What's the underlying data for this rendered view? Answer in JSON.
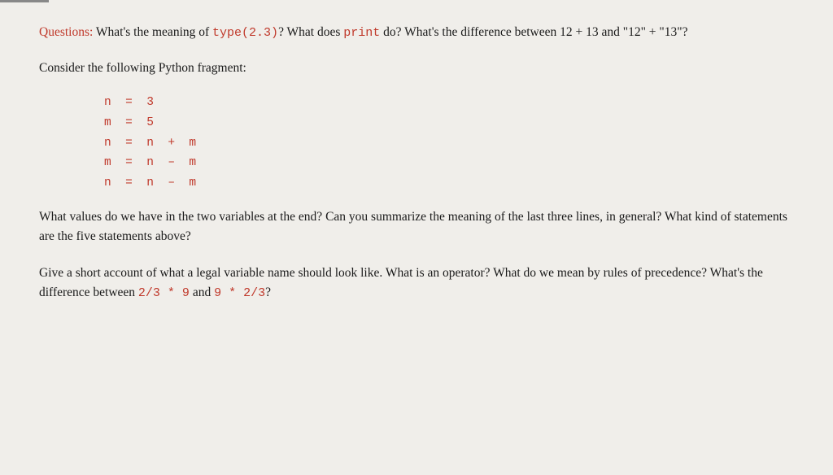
{
  "page": {
    "background": "#f0eeea",
    "top_bar": "—"
  },
  "questions": {
    "label": "Questions:",
    "text1": " What's the meaning of ",
    "code1": "type(2.3)",
    "text2": "? What does ",
    "code2": "print",
    "text3": " do? What's the difference between ",
    "code3": "12 + 13",
    "text4": " and ",
    "code4": "\"12\" + \"13\"",
    "text5": "?"
  },
  "consider": {
    "text": "Consider the following Python fragment:"
  },
  "code_lines": [
    "n  =  3",
    "m  =  5",
    "n  =  n  +  m",
    "m  =  n  –  m",
    "n  =  n  –  m"
  ],
  "values": {
    "text": "What values do we have in the two variables at the end? Can you summarize the meaning of the last three lines, in general? What kind of statements are the five statements above?"
  },
  "give": {
    "text1": "Give a short account of what a legal variable name should look like. What is an operator? What do we mean by rules of precedence? What's the difference between ",
    "code1": "2/3 * 9",
    "text2": " and ",
    "code2": "9 * 2/3",
    "text3": "?"
  }
}
